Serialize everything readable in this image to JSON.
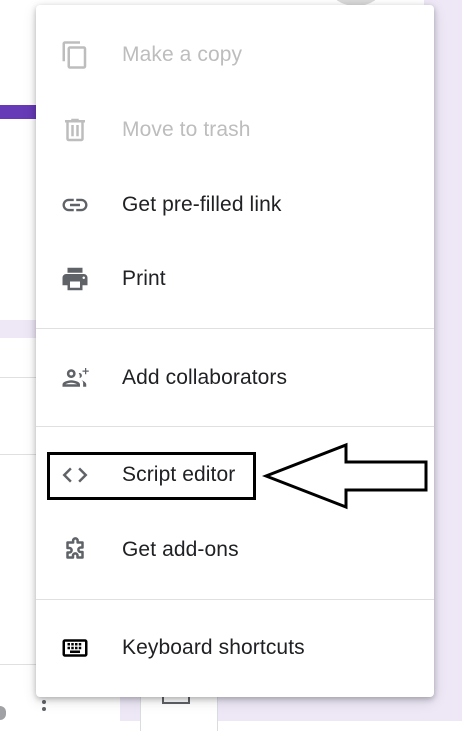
{
  "menu": {
    "items": [
      {
        "label": "Make a copy",
        "icon": "copy-icon",
        "disabled": true
      },
      {
        "label": "Move to trash",
        "icon": "trash-icon",
        "disabled": true
      },
      {
        "label": "Get pre-filled link",
        "icon": "link-icon",
        "disabled": false
      },
      {
        "label": "Print",
        "icon": "print-icon",
        "disabled": false
      },
      {
        "label": "Add collaborators",
        "icon": "add-people-icon",
        "disabled": false
      },
      {
        "label": "Script editor",
        "icon": "code-icon",
        "disabled": false
      },
      {
        "label": "Get add-ons",
        "icon": "puzzle-icon",
        "disabled": false
      },
      {
        "label": "Keyboard shortcuts",
        "icon": "keyboard-icon",
        "disabled": false
      }
    ]
  },
  "colors": {
    "accent": "#673ab7",
    "background_tint": "#ede7f6",
    "icon": "#5f6368",
    "icon_disabled": "#bdbdbd",
    "text": "#202124"
  },
  "annotation": {
    "highlighted_item": "Script editor",
    "marker": "arrow-left-outline"
  }
}
